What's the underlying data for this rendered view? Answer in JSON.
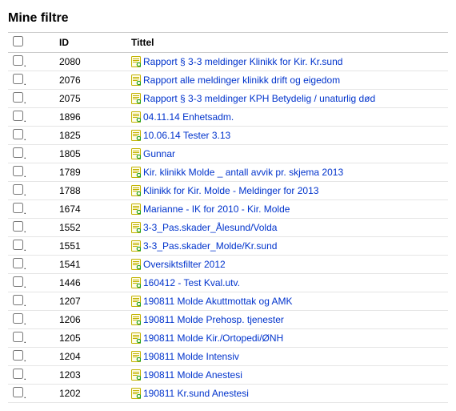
{
  "page_title": "Mine filtre",
  "headers": {
    "id": "ID",
    "title": "Tittel"
  },
  "rows": [
    {
      "id": "2080",
      "title": "Rapport § 3-3 meldinger Klinikk for Kir. Kr.sund"
    },
    {
      "id": "2076",
      "title": "Rapport alle meldinger klinikk drift og eigedom"
    },
    {
      "id": "2075",
      "title": "Rapport § 3-3 meldinger KPH Betydelig / unaturlig død"
    },
    {
      "id": "1896",
      "title": "04.11.14 Enhetsadm."
    },
    {
      "id": "1825",
      "title": "10.06.14 Tester 3.13"
    },
    {
      "id": "1805",
      "title": "Gunnar"
    },
    {
      "id": "1789",
      "title": "Kir. klinikk Molde _ antall avvik pr. skjema 2013"
    },
    {
      "id": "1788",
      "title": "Klinikk for Kir. Molde - Meldinger for 2013"
    },
    {
      "id": "1674",
      "title": "Marianne - IK for 2010 - Kir. Molde"
    },
    {
      "id": "1552",
      "title": "3-3_Pas.skader_Ålesund/Volda"
    },
    {
      "id": "1551",
      "title": "3-3_Pas.skader_Molde/Kr.sund"
    },
    {
      "id": "1541",
      "title": "Oversiktsfilter 2012"
    },
    {
      "id": "1446",
      "title": "160412 - Test Kval.utv."
    },
    {
      "id": "1207",
      "title": "190811 Molde Akuttmottak og AMK"
    },
    {
      "id": "1206",
      "title": "190811 Molde Prehosp. tjenester"
    },
    {
      "id": "1205",
      "title": "190811 Molde Kir./Ortopedi/ØNH"
    },
    {
      "id": "1204",
      "title": "190811 Molde Intensiv"
    },
    {
      "id": "1203",
      "title": "190811 Molde Anestesi"
    },
    {
      "id": "1202",
      "title": "190811 Kr.sund Anestesi"
    }
  ]
}
